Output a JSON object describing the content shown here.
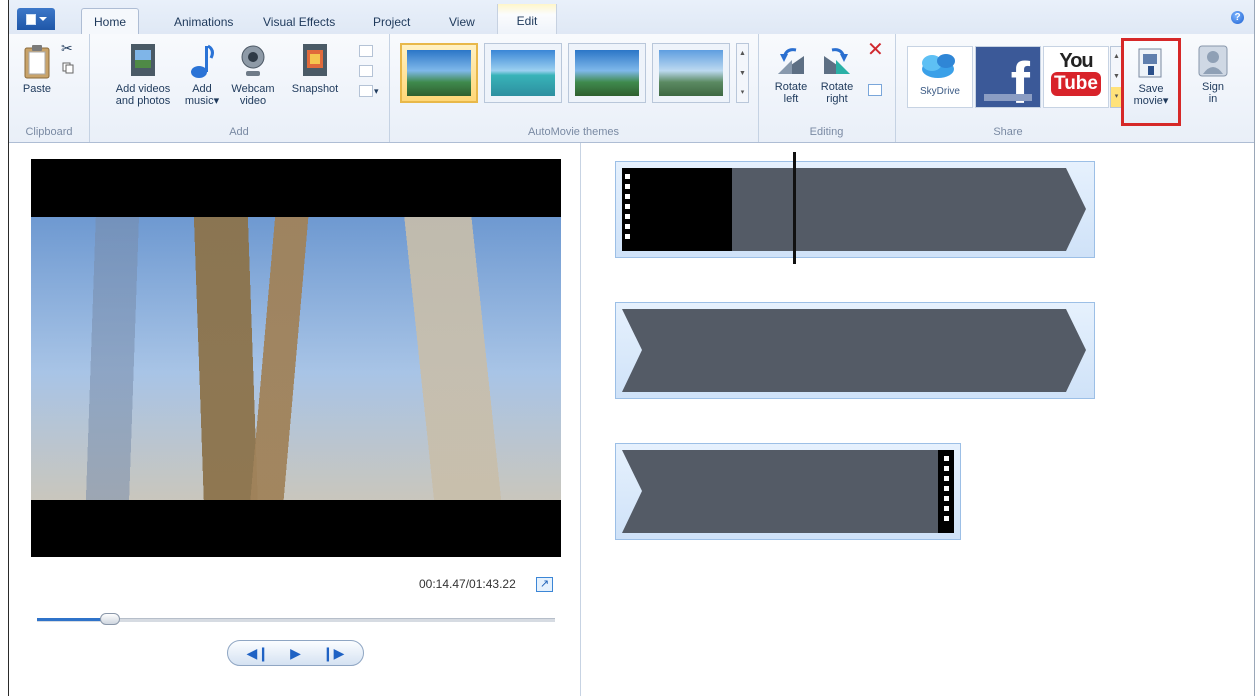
{
  "tabs": [
    {
      "label": "Home",
      "active": true
    },
    {
      "label": "Animations"
    },
    {
      "label": "Visual Effects"
    },
    {
      "label": "Project"
    },
    {
      "label": "View"
    },
    {
      "label": "Edit",
      "contextual": true
    }
  ],
  "help_icon": "?",
  "groups": {
    "clipboard": {
      "label": "Clipboard",
      "paste": "Paste"
    },
    "add": {
      "label": "Add",
      "add_videos": [
        "Add videos",
        "and photos"
      ],
      "add_music": [
        "Add",
        "music"
      ],
      "webcam": [
        "Webcam",
        "video"
      ],
      "snapshot": "Snapshot"
    },
    "themes": {
      "label": "AutoMovie themes"
    },
    "editing": {
      "label": "Editing",
      "rotate_left": [
        "Rotate",
        "left"
      ],
      "rotate_right": [
        "Rotate",
        "right"
      ]
    },
    "share": {
      "label": "Share",
      "skydrive": "SkyDrive",
      "facebook": "f",
      "youtube_top": "You",
      "youtube_bottom": "Tube",
      "save_movie": [
        "Save",
        "movie"
      ],
      "sign_in": [
        "Sign",
        "in"
      ]
    }
  },
  "preview": {
    "timecode": "00:14.47/01:43.22",
    "seek_progress": 0.14,
    "controls": {
      "prev": "◀❙",
      "play": "▶",
      "next": "❙▶"
    }
  },
  "colors": {
    "highlight": "#d62828",
    "accent": "#2f73c9"
  }
}
